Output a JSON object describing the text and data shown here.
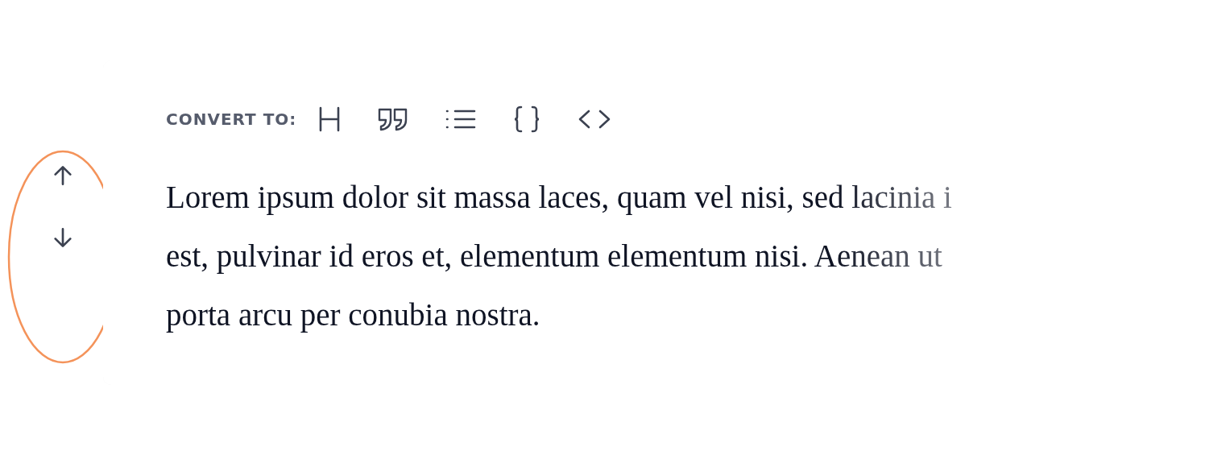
{
  "toolbar": {
    "label": "CONVERT TO:"
  },
  "paragraph_lines": [
    "Lorem ipsum dolor sit massa laces, quam vel nisi, sed lacinia i",
    "est, pulvinar id eros et, elementum elementum nisi. Aenean ut",
    "porta arcu per conubia nostra."
  ]
}
